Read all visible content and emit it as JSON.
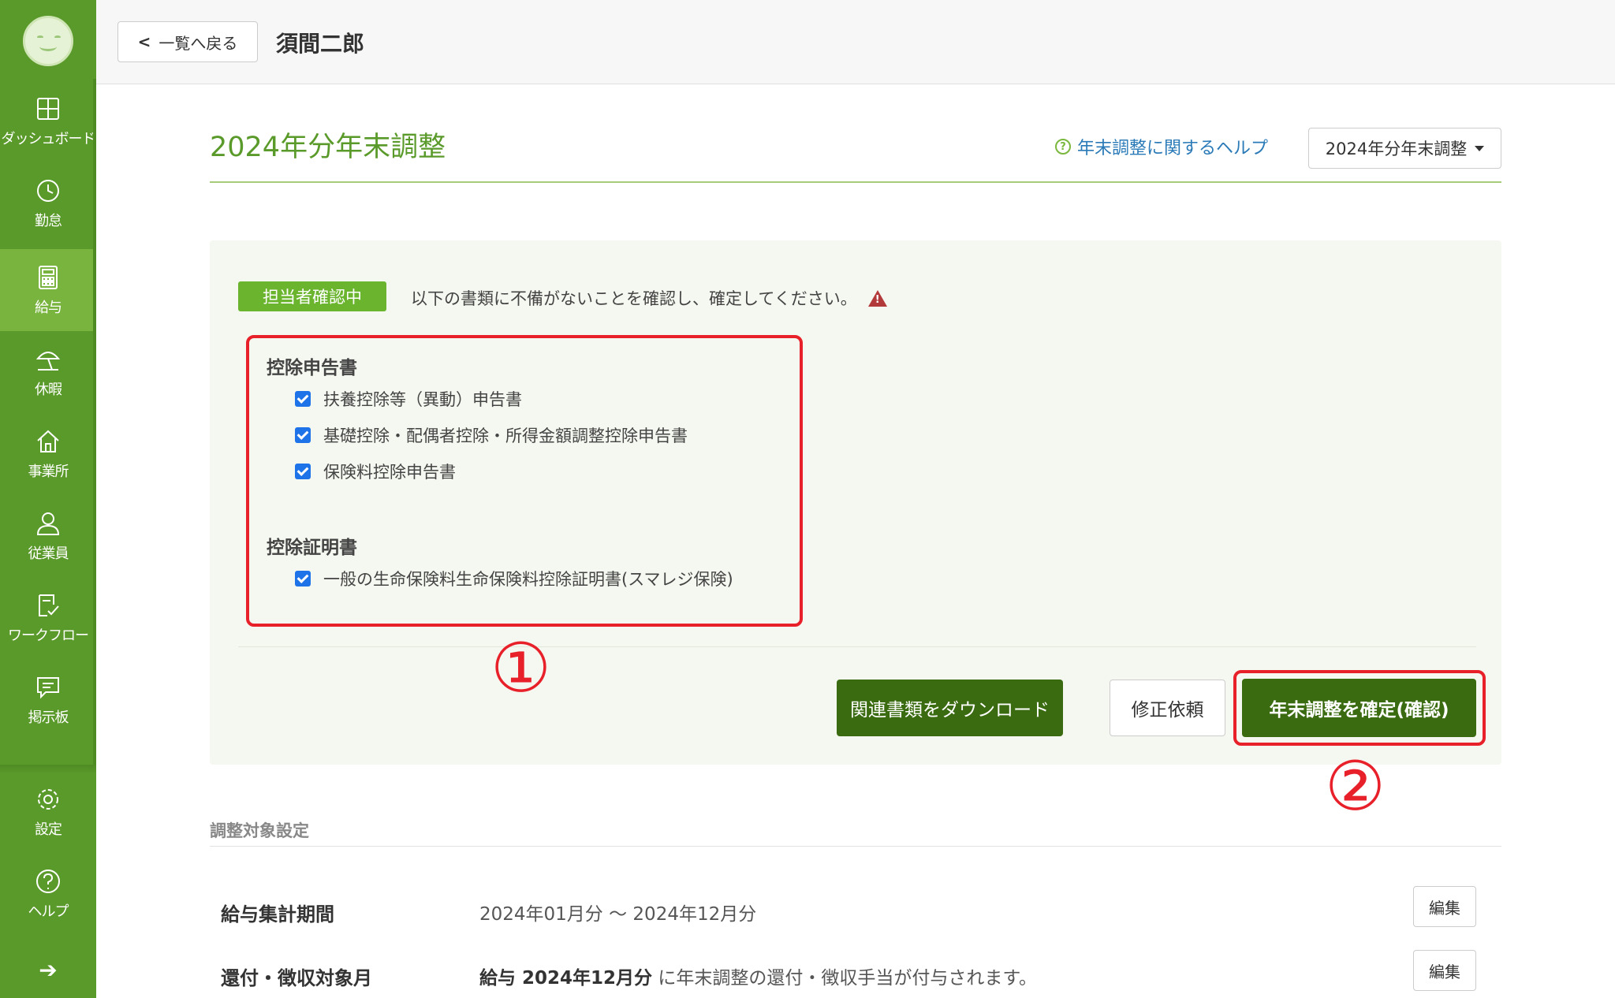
{
  "sidebar": {
    "items": [
      {
        "label": "ダッシュボード",
        "icon": "dashboard-icon"
      },
      {
        "label": "勤怠",
        "icon": "clock-icon"
      },
      {
        "label": "給与",
        "icon": "calculator-icon"
      },
      {
        "label": "休暇",
        "icon": "beach-umbrella-icon"
      },
      {
        "label": "事業所",
        "icon": "home-icon"
      },
      {
        "label": "従業員",
        "icon": "person-icon"
      },
      {
        "label": "ワークフロー",
        "icon": "checklist-icon"
      },
      {
        "label": "掲示板",
        "icon": "message-board-icon"
      },
      {
        "label": "設定",
        "icon": "gear-icon"
      },
      {
        "label": "ヘルプ",
        "icon": "help-icon"
      }
    ],
    "collapse_glyph": "➔"
  },
  "header": {
    "back_label": "一覧へ戻る",
    "employee_name": "須間二郎"
  },
  "title_row": {
    "page_title": "2024年分年末調整",
    "help_link": "年末調整に関するヘルプ",
    "year_select": "2024年分年末調整"
  },
  "panel": {
    "status_badge": "担当者確認中",
    "status_message": "以下の書類に不備がないことを確認し、確定してください。",
    "sections": [
      {
        "heading": "控除申告書",
        "items": [
          "扶養控除等（異動）申告書",
          "基礎控除・配偶者控除・所得金額調整控除申告書",
          "保険料控除申告書"
        ]
      },
      {
        "heading": "控除証明書",
        "items": [
          "一般の生命保険料生命保険料控除証明書(スマレジ保険)"
        ]
      }
    ],
    "download_label": "関連書類をダウンロード",
    "revise_label": "修正依頼",
    "confirm_label": "年末調整を確定(確認)"
  },
  "annotations": {
    "one": "①",
    "two": "②"
  },
  "adjustment": {
    "title": "調整対象設定",
    "rows": [
      {
        "label": "給与集計期間",
        "value": "2024年01月分 〜 2024年12月分",
        "edit": "編集"
      },
      {
        "label": "還付・徴収対象月",
        "value_bold": "給与 2024年12月分",
        "value_rest": " に年末調整の還付・徴収手当が付与されます。",
        "edit": "編集"
      }
    ]
  },
  "colors": {
    "sidebar": "#5a9a2a",
    "accent_green": "#3a6b10",
    "badge_green": "#6ab42e",
    "annotation_red": "#e8202a",
    "link_blue": "#2a7ab8"
  }
}
